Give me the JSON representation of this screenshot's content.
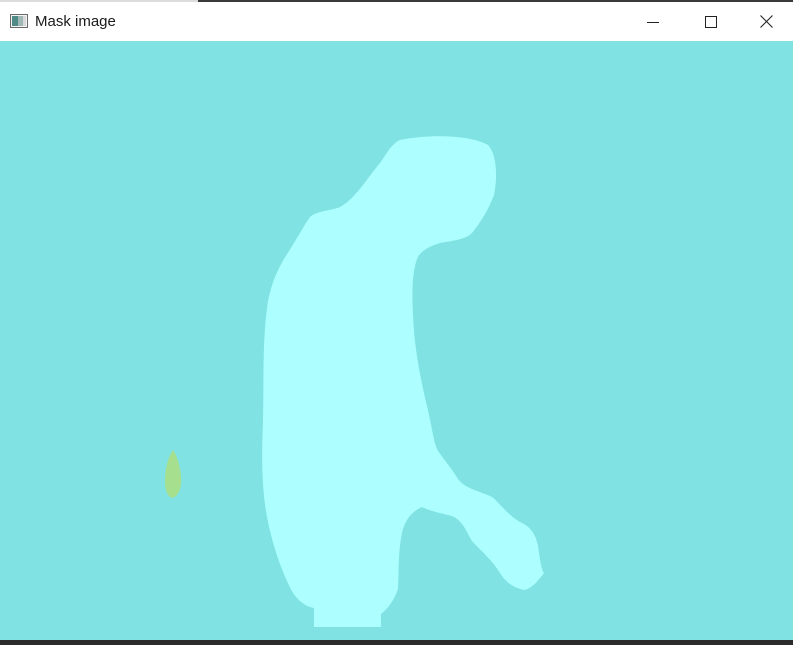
{
  "window": {
    "title": "Mask image",
    "icon": "app-window-icon",
    "controls": {
      "minimize_icon": "minimize-icon",
      "maximize_icon": "maximize-icon",
      "close_icon": "close-icon"
    }
  },
  "canvas": {
    "background_color": "#80e2e2",
    "regions": [
      {
        "name": "large-mask-region",
        "color": "#adffff"
      },
      {
        "name": "small-mask-region",
        "color": "#a6e08e"
      }
    ]
  }
}
